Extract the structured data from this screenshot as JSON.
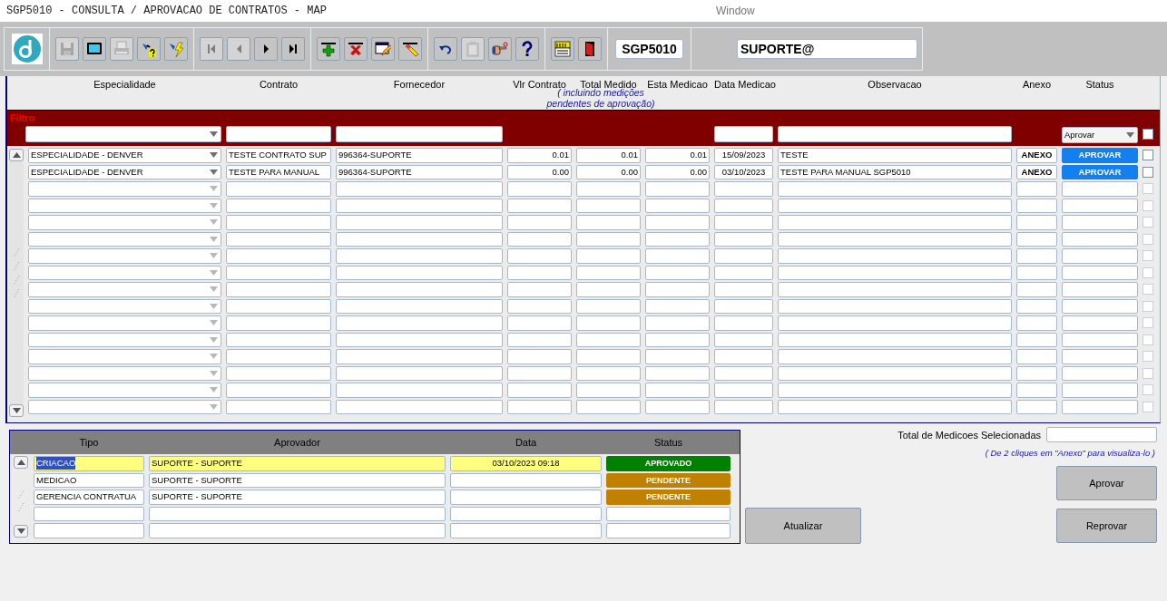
{
  "window": {
    "title": "SGP5010 - CONSULTA / APROVACAO DE CONTRATOS - MAP",
    "caption": "Window"
  },
  "toolbar": {
    "groups": [
      [
        {
          "kind": "save",
          "disabled": true
        },
        {
          "kind": "screen",
          "disabled": false
        },
        {
          "kind": "print",
          "disabled": true
        },
        {
          "kind": "query",
          "disabled": false
        },
        {
          "kind": "execute",
          "disabled": false
        }
      ],
      [
        {
          "kind": "first",
          "disabled": true
        },
        {
          "kind": "prev",
          "disabled": true
        },
        {
          "kind": "next",
          "disabled": false
        },
        {
          "kind": "last",
          "disabled": false
        }
      ],
      [
        {
          "kind": "insert",
          "disabled": false
        },
        {
          "kind": "delete",
          "disabled": false
        },
        {
          "kind": "edit",
          "disabled": false
        },
        {
          "kind": "clear",
          "disabled": false
        }
      ],
      [
        {
          "kind": "undo",
          "disabled": false
        },
        {
          "kind": "clipboard",
          "disabled": true
        },
        {
          "kind": "hand",
          "disabled": false
        },
        {
          "kind": "help",
          "disabled": false
        }
      ],
      [
        {
          "kind": "menu",
          "disabled": false
        },
        {
          "kind": "exit",
          "disabled": false
        }
      ]
    ],
    "module": "SGP5010",
    "user": "SUPORTE@"
  },
  "grid": {
    "columns": [
      "Especialidade",
      "Contrato",
      "Fornecedor",
      "Vlr Contrato",
      "Total Medido",
      "Esta Medicao",
      "Data Medicao",
      "Observacao",
      "Anexo",
      "Status"
    ],
    "note": "( incluindo medições pendentes de aprovação)",
    "filter": {
      "label": "Filtro",
      "status": "Aprovar",
      "checked": false
    },
    "rows": [
      {
        "especialidade": "ESPECIALIDADE - DENVER",
        "contrato": "TESTE CONTRATO SUP",
        "fornecedor": "996364-SUPORTE",
        "vlr_contrato": "0.01",
        "total_medido": "0.01",
        "esta_medicao": "0.01",
        "data_medicao": "15/09/2023",
        "observacao": "TESTE",
        "anexo": "ANEXO",
        "status": "APROVAR",
        "checked": false,
        "disabled": false
      },
      {
        "especialidade": "ESPECIALIDADE - DENVER",
        "contrato": "TESTE PARA MANUAL",
        "fornecedor": "996364-SUPORTE",
        "vlr_contrato": "0.00",
        "total_medido": "0.00",
        "esta_medicao": "0.00",
        "data_medicao": "03/10/2023",
        "observacao": "TESTE PARA MANUAL SGP5010",
        "anexo": "ANEXO",
        "status": "APROVAR",
        "checked": false,
        "disabled": false
      },
      {
        "checked": false,
        "disabled": true
      },
      {
        "checked": false,
        "disabled": true
      },
      {
        "checked": false,
        "disabled": true
      },
      {
        "checked": false,
        "disabled": true
      },
      {
        "checked": false,
        "disabled": true
      },
      {
        "checked": false,
        "disabled": true
      },
      {
        "checked": false,
        "disabled": true
      },
      {
        "checked": false,
        "disabled": true
      },
      {
        "checked": false,
        "disabled": true
      },
      {
        "checked": false,
        "disabled": true
      },
      {
        "checked": false,
        "disabled": true
      },
      {
        "checked": false,
        "disabled": true
      },
      {
        "checked": false,
        "disabled": true
      },
      {
        "checked": false,
        "disabled": true
      }
    ]
  },
  "approvals": {
    "columns": [
      "Tipo",
      "Aprovador",
      "Data",
      "Status"
    ],
    "rows": [
      {
        "tipo": "CRIACAO",
        "aprovador": "SUPORTE - SUPORTE",
        "data": "03/10/2023 09:18",
        "status": "APROVADO",
        "color": "#008000",
        "selected": true
      },
      {
        "tipo": "MEDICAO",
        "aprovador": "SUPORTE - SUPORTE",
        "status": "PENDENTE",
        "color": "#c08000",
        "selected": false
      },
      {
        "tipo": "GERENCIA CONTRATUA",
        "aprovador": "SUPORTE - SUPORTE",
        "status": "PENDENTE",
        "color": "#c08000",
        "selected": false
      }
    ]
  },
  "actions": {
    "total_label": "Total de Medicoes Selecionadas",
    "hint": "( De 2 cliques em \"Anexo\" para visualiza-lo )",
    "refresh": "Atualizar",
    "approve": "Aprovar",
    "reject": "Reprovar"
  }
}
